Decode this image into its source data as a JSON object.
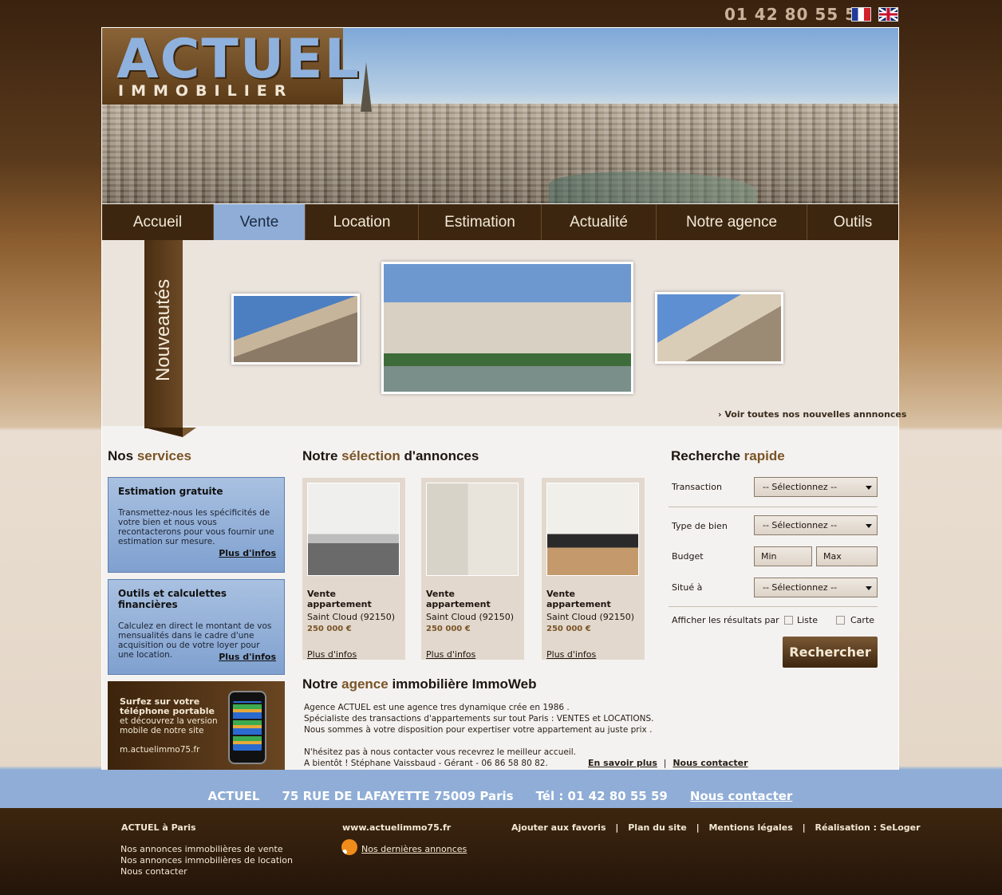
{
  "header": {
    "phone": "01 42 80 55 59",
    "flags": [
      {
        "name": "french-flag-icon"
      },
      {
        "name": "english-flag-icon"
      }
    ]
  },
  "logo": {
    "main": "ACTUEL",
    "sub": "IMMOBILIER"
  },
  "nav": {
    "items": [
      {
        "label": "Accueil",
        "active": false
      },
      {
        "label": "Vente",
        "active": true
      },
      {
        "label": "Location",
        "active": false
      },
      {
        "label": "Estimation",
        "active": false
      },
      {
        "label": "Actualité",
        "active": false
      },
      {
        "label": "Notre agence",
        "active": false
      },
      {
        "label": "Outils",
        "active": false
      }
    ]
  },
  "nouveautes": {
    "ribbon": "Nouveautés",
    "see_all": "› Voir toutes nos nouvelles annnonces"
  },
  "services": {
    "title_plain": "Nos ",
    "title_accent": "services",
    "boxes": [
      {
        "title": "Estimation gratuite",
        "text": "Transmettez-nous les spécificités de votre bien et nous vous recontacterons pour vous fournir une estimation sur mesure.",
        "link": "Plus d'infos"
      },
      {
        "title": "Outils et calculettes financières",
        "text": "Calculez en direct le montant de vos mensualités dans le cadre d'une acquisition ou de votre loyer pour une location.",
        "link": "Plus d'infos"
      }
    ],
    "mobile": {
      "bold": "Surfez sur votre téléphone portable",
      "text": "et découvrez la version mobile de notre site",
      "url": "m.actuelimmo75.fr"
    }
  },
  "selection": {
    "title_a": "Notre ",
    "title_accent": "sélection",
    "title_b": " d'annonces",
    "cards": [
      {
        "type": "Vente appartement",
        "city": "Saint Cloud  (92150)",
        "price": "250 000 €",
        "link": "Plus d'infos"
      },
      {
        "type": "Vente appartement",
        "city": "Saint Cloud  (92150)",
        "price": "250 000 €",
        "link": "Plus d'infos"
      },
      {
        "type": "Vente appartement",
        "city": "Saint Cloud  (92150)",
        "price": "250 000 €",
        "link": "Plus d'infos"
      }
    ]
  },
  "agency": {
    "title_a": "Notre ",
    "title_accent": "agence",
    "title_b": " immobilière ImmoWeb",
    "lines": [
      "Agence ACTUEL est une agence tres dynamique crée en 1986 .",
      "Spécialiste des transactions d'appartements sur tout Paris : VENTES et LOCATIONS.",
      "Nous sommes à votre disposition pour expertiser votre appartement au juste prix .",
      "",
      "N'hésitez pas à nous contacter vous recevrez le meilleur accueil.",
      "A bientôt ! Stéphane Vaissbaud - Gérant - 06 86 58 80 82."
    ],
    "link_more": "En savoir plus",
    "sep": "|",
    "link_contact": "Nous contacter"
  },
  "search": {
    "title_plain": "Recherche ",
    "title_accent": "rapide",
    "transaction_label": "Transaction",
    "transaction_value": "-- Sélectionnez --",
    "type_label": "Type de bien",
    "type_value": "-- Sélectionnez --",
    "budget_label": "Budget",
    "min_placeholder": "Min",
    "max_placeholder": "Max",
    "location_label": "Situé à",
    "location_value": "-- Sélectionnez --",
    "display_label": "Afficher les résultats par",
    "opt_list": "Liste",
    "opt_map": "Carte",
    "button": "Rechercher"
  },
  "bluebar": {
    "name": "ACTUEL",
    "address": "75 RUE DE LAFAYETTE 75009 Paris",
    "phone": "Tél : 01 42 80 55 59",
    "contact": "Nous contacter"
  },
  "footer": {
    "col1_title": "ACTUEL à Paris",
    "col1_links": [
      "Nos annonces immobilières de vente",
      "Nos annonces immobilières de location",
      "Nous contacter"
    ],
    "col2_title": "www.actuelimmo75.fr",
    "col2_rss": "Nos dernières annonces",
    "col3_links": [
      "Ajouter aux favoris",
      "Plan du site",
      "Mentions légales",
      "Réalisation : SeLoger"
    ],
    "col3_sep": "|"
  }
}
